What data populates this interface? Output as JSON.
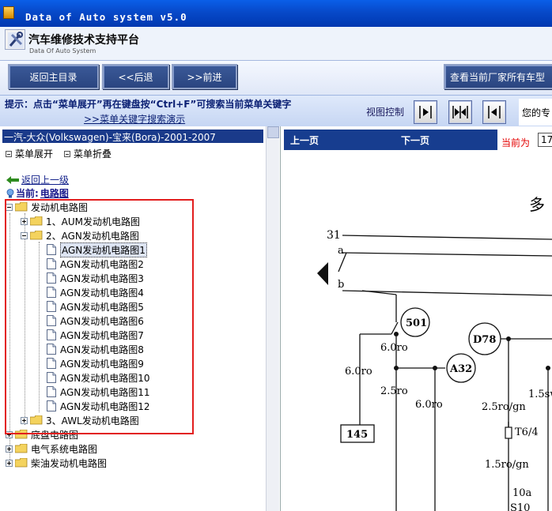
{
  "window": {
    "title": "Data of Auto system v5.0"
  },
  "header": {
    "title_cn": "汽车维修技术支持平台",
    "subtitle_en": "Data Of Auto System"
  },
  "toolbar": {
    "main_menu": "返回主目录",
    "back": "<<后退",
    "forward": ">>前进",
    "all_models": "查看当前厂家所有车型"
  },
  "hint": {
    "line1": "提示：点击“菜单展开”再在键盘按“Ctrl+F”可搜索当前菜单关键字",
    "line2": ">>菜单关键字搜索演示"
  },
  "view_control": {
    "label": "视图控制",
    "marquee": "您的专"
  },
  "left": {
    "vehicle": "一汽-大众(Volkswagen)-宝来(Bora)-2001-2007",
    "expand_menu": "菜单展开",
    "collapse_menu": "菜单折叠",
    "back_up": "返回上一级",
    "current_prefix": "当前:",
    "current_label": "电路图",
    "tree": [
      {
        "label": "发动机电路图"
      },
      {
        "label": "1、AUM发动机电路图"
      },
      {
        "label": "2、AGN发动机电路图"
      },
      {
        "label": "AGN发动机电路图1"
      },
      {
        "label": "AGN发动机电路图2"
      },
      {
        "label": "AGN发动机电路图3"
      },
      {
        "label": "AGN发动机电路图4"
      },
      {
        "label": "AGN发动机电路图5"
      },
      {
        "label": "AGN发动机电路图6"
      },
      {
        "label": "AGN发动机电路图7"
      },
      {
        "label": "AGN发动机电路图8"
      },
      {
        "label": "AGN发动机电路图9"
      },
      {
        "label": "AGN发动机电路图10"
      },
      {
        "label": "AGN发动机电路图11"
      },
      {
        "label": "AGN发动机电路图12"
      },
      {
        "label": "3、AWL发动机电路图"
      },
      {
        "label": "底盘电路图"
      },
      {
        "label": "电气系统电路图"
      },
      {
        "label": "柴油发动机电路图"
      }
    ]
  },
  "right": {
    "prev": "上一页",
    "next": "下一页",
    "current_label": "当前为",
    "current_page": "17",
    "diagram": {
      "title_fragment": "多",
      "rail_31": "31",
      "rail_a": "a",
      "rail_b": "b",
      "c501": "501",
      "cD78": "D78",
      "cA32": "A32",
      "w1": "6.0ro",
      "w2": "6.0ro",
      "w3": "2.5ro",
      "w4": "6.0ro",
      "w5": "2.5ro/gn",
      "w6": "1.5sw",
      "t64": "T6/4",
      "w7": "1.5ro/gn",
      "b145": "145",
      "w8": "10a",
      "w9": "S10"
    }
  }
}
